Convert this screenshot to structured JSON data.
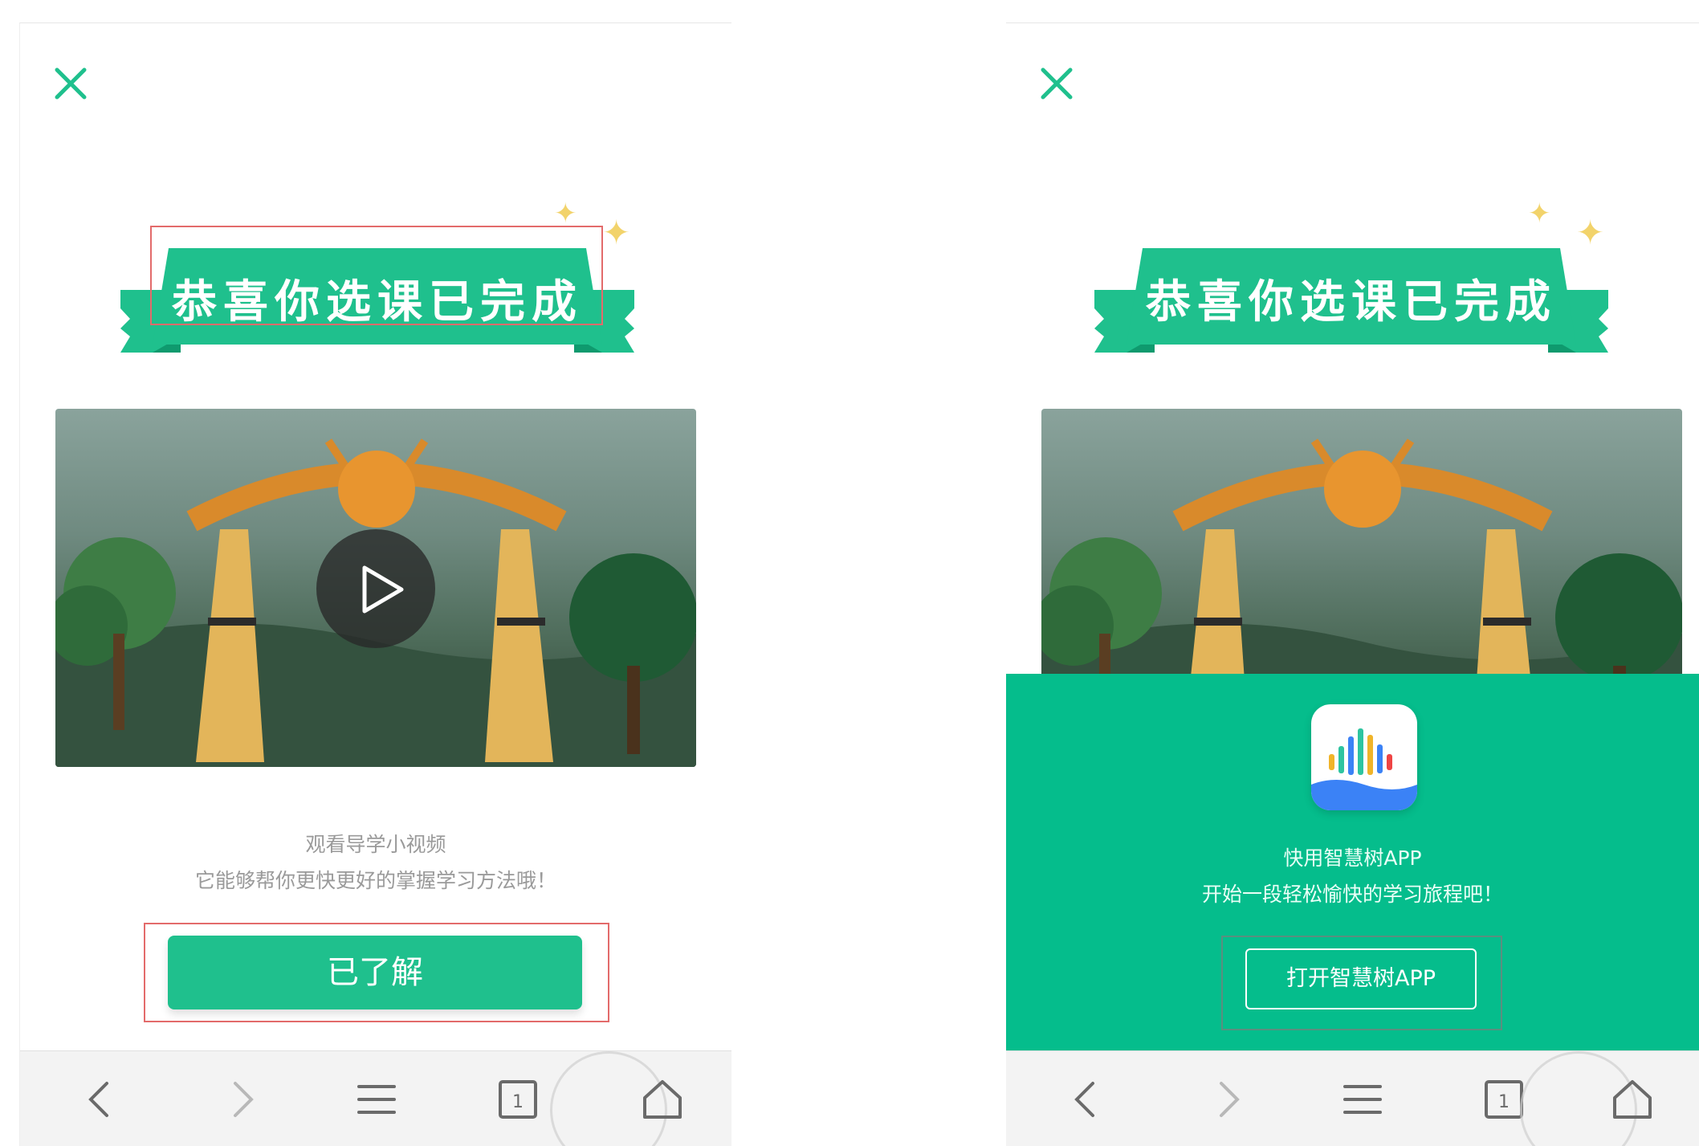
{
  "colors": {
    "brand_green": "#1fc08d",
    "overlay_green": "#05bd8c",
    "highlight_red": "#e36b6b"
  },
  "left_screen": {
    "close_icon": "close-icon",
    "banner_title": "恭喜你选课已完成",
    "video_play_icon": "play-icon",
    "hint_line1": "观看导学小视频",
    "hint_line2": "它能够帮你更快更好的掌握学习方法哦！",
    "confirm_button": "已了解"
  },
  "right_screen": {
    "close_icon": "close-icon",
    "banner_title": "恭喜你选课已完成",
    "app_icon": "zhihuishu-app-icon",
    "promo_line1": "快用智慧树APP",
    "promo_line2": "开始一段轻松愉快的学习旅程吧！",
    "open_app_button": "打开智慧树APP"
  },
  "bottom_nav": {
    "icons": [
      "back-icon",
      "forward-icon",
      "menu-icon",
      "tabs-icon",
      "home-icon"
    ],
    "tabs_count": "1"
  }
}
